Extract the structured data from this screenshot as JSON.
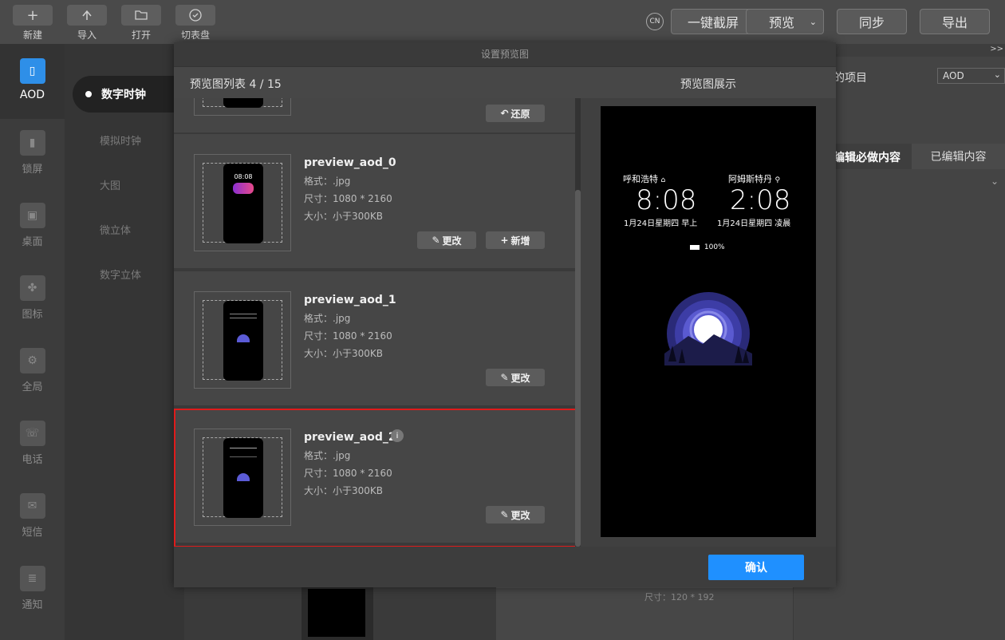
{
  "toolbar": {
    "new": "新建",
    "import": "导入",
    "open": "打开",
    "switch_dial": "切表盘",
    "lang": "CN",
    "screenshot": "一键截屏",
    "preview": "预览",
    "sync": "同步",
    "export": "导出"
  },
  "rail": {
    "items": [
      {
        "label": "AOD"
      },
      {
        "label": "锁屏"
      },
      {
        "label": "桌面"
      },
      {
        "label": "图标"
      },
      {
        "label": "全局"
      },
      {
        "label": "电话"
      },
      {
        "label": "短信"
      },
      {
        "label": "通知"
      }
    ]
  },
  "categories": {
    "active": "数字时钟",
    "items": [
      "模拟时钟",
      "大图",
      "微立体",
      "数字立体"
    ]
  },
  "right_panel": {
    "collapse": ">>",
    "project_label": "的项目",
    "project_value": "AOD",
    "tab_required": "编辑必做内容",
    "tab_edited": "已编辑内容",
    "size_hint": "尺寸：120 * 192"
  },
  "dialog": {
    "title": "设置预览图",
    "list_title": "预览图列表 4 / 15",
    "preview_title": "预览图展示",
    "confirm": "确认",
    "restore": "还原",
    "items": [
      {
        "name": "preview_aod_0",
        "format": "格式：.jpg",
        "dims": "尺寸：1080 * 2160",
        "size": "大小：小于300KB",
        "edit": "更改",
        "add": "新增",
        "thumb_time": "08:08"
      },
      {
        "name": "preview_aod_1",
        "format": "格式：.jpg",
        "dims": "尺寸：1080 * 2160",
        "size": "大小：小于300KB",
        "edit": "更改"
      },
      {
        "name": "preview_aod_2",
        "format": "格式：.jpg",
        "dims": "尺寸：1080 * 2160",
        "size": "大小：小于300KB",
        "edit": "更改",
        "info": "i"
      }
    ]
  },
  "preview": {
    "city1": "呼和浩特",
    "city2": "阿姆斯特丹",
    "time1": "8:08",
    "time2": "2:08",
    "date1": "1月24日星期四 早上",
    "date2": "1月24日星期四 凌晨",
    "battery": "100%"
  },
  "colors": {
    "accent": "#1f90ff",
    "highlight": "#e01b1b"
  }
}
